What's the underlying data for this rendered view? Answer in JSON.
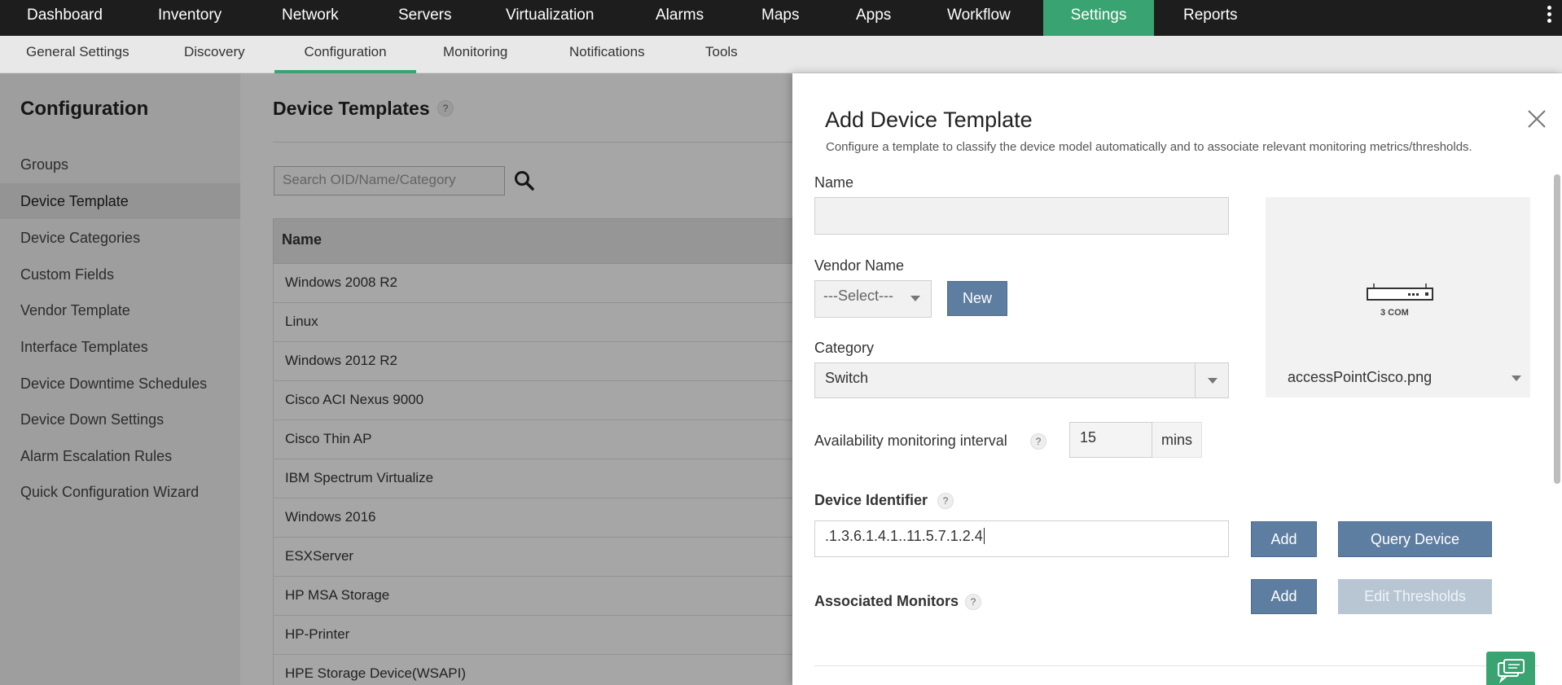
{
  "topnav": {
    "items": [
      {
        "label": "Dashboard"
      },
      {
        "label": "Inventory"
      },
      {
        "label": "Network"
      },
      {
        "label": "Servers"
      },
      {
        "label": "Virtualization"
      },
      {
        "label": "Alarms"
      },
      {
        "label": "Maps"
      },
      {
        "label": "Apps"
      },
      {
        "label": "Workflow"
      },
      {
        "label": "Settings"
      },
      {
        "label": "Reports"
      }
    ],
    "active": "Settings"
  },
  "subnav": {
    "items": [
      {
        "label": "General Settings"
      },
      {
        "label": "Discovery"
      },
      {
        "label": "Configuration"
      },
      {
        "label": "Monitoring"
      },
      {
        "label": "Notifications"
      },
      {
        "label": "Tools"
      }
    ],
    "active": "Configuration"
  },
  "sidebar": {
    "heading": "Configuration",
    "items": [
      {
        "label": "Groups"
      },
      {
        "label": "Device Template"
      },
      {
        "label": "Device Categories"
      },
      {
        "label": "Custom Fields"
      },
      {
        "label": "Vendor Template"
      },
      {
        "label": "Interface Templates"
      },
      {
        "label": "Device Downtime Schedules"
      },
      {
        "label": "Device Down Settings"
      },
      {
        "label": "Alarm Escalation Rules"
      },
      {
        "label": "Quick Configuration Wizard"
      }
    ],
    "active": "Device Template"
  },
  "main": {
    "title": "Device Templates",
    "help": "?",
    "search_placeholder": "Search OID/Name/Category",
    "table": {
      "columns": [
        "Name"
      ],
      "rows": [
        "Windows 2008 R2",
        "Linux",
        "Windows 2012 R2",
        "Cisco ACI Nexus 9000",
        "Cisco Thin AP",
        "IBM Spectrum Virtualize",
        "Windows 2016",
        "ESXServer",
        "HP MSA Storage",
        "HP-Printer",
        "HPE Storage Device(WSAPI)"
      ]
    }
  },
  "panel": {
    "title": "Add Device Template",
    "description": "Configure a template to classify the device model automatically and to associate relevant monitoring metrics/thresholds.",
    "name_label": "Name",
    "name_value": "",
    "vendor_label": "Vendor Name",
    "vendor_value": "---Select---",
    "new_button": "New",
    "category_label": "Category",
    "category_value": "Switch",
    "availability_label": "Availability monitoring interval",
    "availability_help": "?",
    "interval_value": "15",
    "interval_unit": "mins",
    "device_identifier_label": "Device Identifier",
    "device_identifier_help": "?",
    "device_identifier_value": ".1.3.6.1.4.1..11.5.7.1.2.4",
    "add_button": "Add",
    "query_button": "Query Device",
    "associated_label": "Associated Monitors",
    "associated_help": "?",
    "add_monitor_button": "Add",
    "edit_thresholds_button": "Edit Thresholds",
    "image_name": "accessPointCisco.png",
    "image_caption": "3 COM"
  },
  "colors": {
    "topnav_bg": "#1d1d1d",
    "accent_green": "#3aa372",
    "button_blue": "#5e7ea1",
    "button_disabled": "#b8c6d4"
  }
}
